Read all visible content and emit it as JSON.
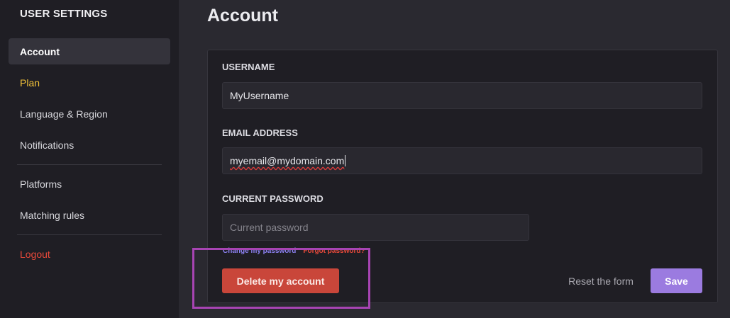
{
  "sidebar": {
    "title": "USER SETTINGS",
    "items": [
      {
        "label": "Account"
      },
      {
        "label": "Plan"
      },
      {
        "label": "Language & Region"
      },
      {
        "label": "Notifications"
      },
      {
        "label": "Platforms"
      },
      {
        "label": "Matching rules"
      },
      {
        "label": "Logout"
      }
    ]
  },
  "main": {
    "title": "Account",
    "form": {
      "username_label": "USERNAME",
      "username_value": "MyUsername",
      "email_label": "EMAIL ADDRESS",
      "email_value": "myemail@mydomain.com",
      "password_label": "CURRENT PASSWORD",
      "password_placeholder": "Current password",
      "change_password_link": "Change my password",
      "forgot_password_link": "Forgot password?"
    },
    "actions": {
      "delete_label": "Delete my account",
      "reset_label": "Reset the form",
      "save_label": "Save"
    }
  },
  "colors": {
    "accent": "#9b7be0",
    "danger": "#c9463a",
    "plan": "#f2c23a",
    "logout": "#e8493a",
    "highlight": "#a744b3"
  }
}
